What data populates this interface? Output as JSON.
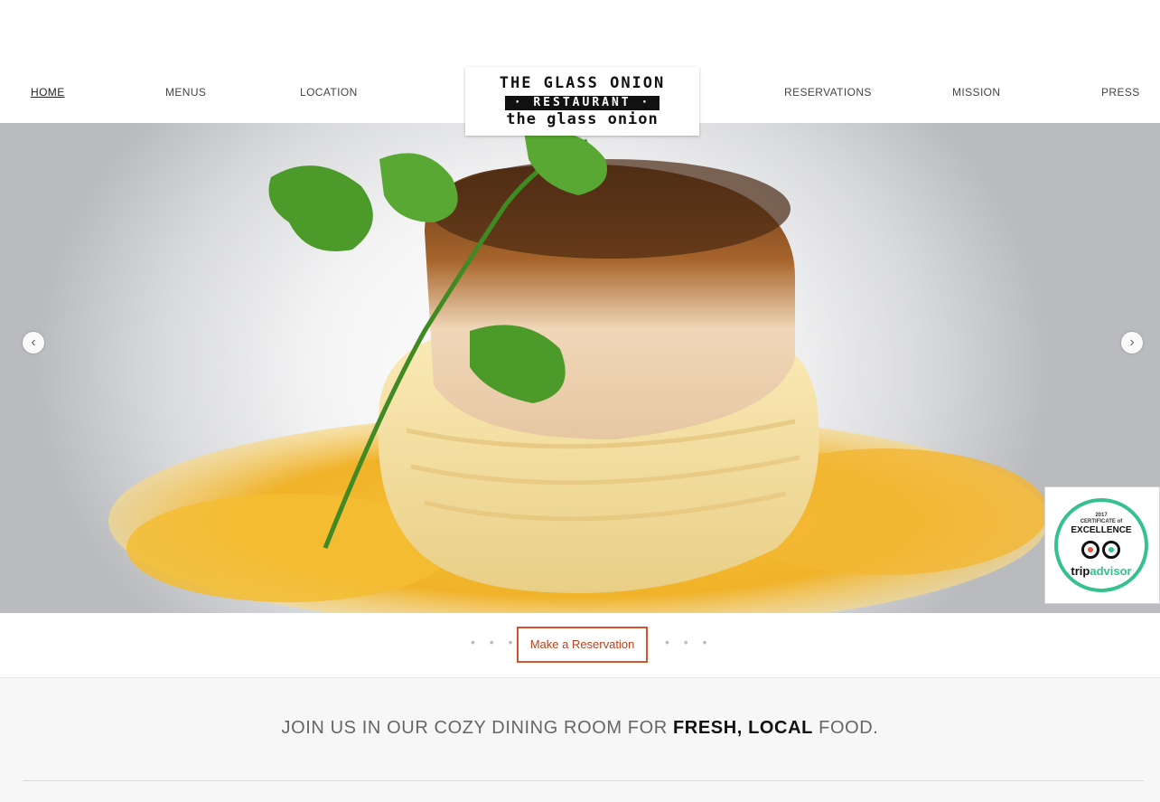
{
  "nav": {
    "items": [
      {
        "label": "HOME",
        "active": true
      },
      {
        "label": "MENUS"
      },
      {
        "label": "LOCATION"
      },
      {
        "label": "RESERVATIONS"
      },
      {
        "label": "MISSION"
      },
      {
        "label": "PRESS"
      }
    ]
  },
  "logo": {
    "line1": "THE GLASS ONION",
    "line2": "· RESTAURANT ·",
    "line3": "the glass onion"
  },
  "hero": {
    "prev_icon": "chevron-left-icon",
    "next_icon": "chevron-right-icon",
    "prev_glyph": "‹",
    "next_glyph": "›"
  },
  "badge": {
    "year": "2017",
    "certificate": "CERTIFICATE of",
    "excellence": "EXCELLENCE",
    "brand_a": "trip",
    "brand_b": "advisor"
  },
  "strip": {
    "button_label": "Make a Reservation",
    "dots": "• • •"
  },
  "tagline": {
    "prefix": "JOIN US IN OUR COZY DINING ROOM FOR ",
    "bold": "FRESH, LOCAL",
    "suffix": " FOOD."
  },
  "colors": {
    "accent": "#d2542c",
    "tripadvisor_green": "#34c08f"
  }
}
